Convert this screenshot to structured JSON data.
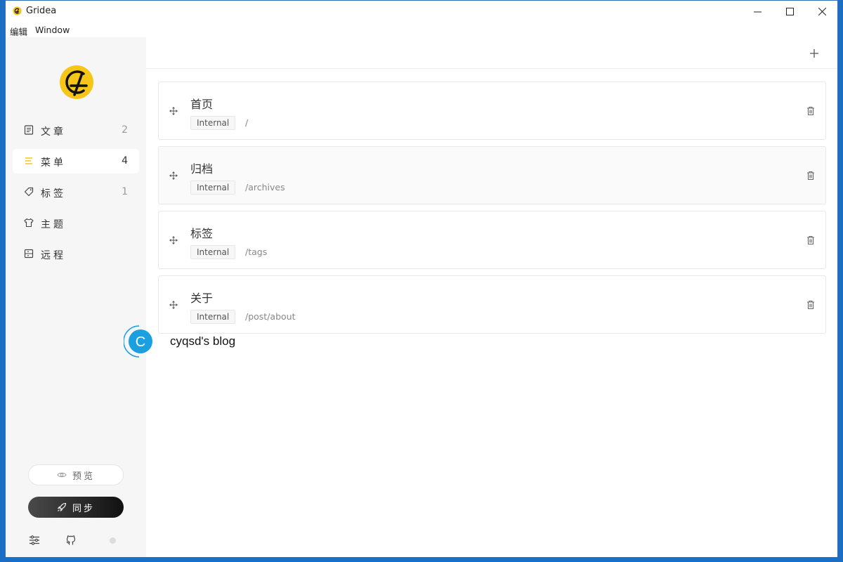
{
  "window": {
    "title": "Gridea"
  },
  "menubar": {
    "items": [
      "编辑",
      "Window"
    ]
  },
  "sidebar": {
    "nav": [
      {
        "label": "文章",
        "count": "2",
        "icon": "article-icon"
      },
      {
        "label": "菜单",
        "count": "4",
        "icon": "menu-icon",
        "active": true
      },
      {
        "label": "标签",
        "count": "1",
        "icon": "tag-icon"
      },
      {
        "label": "主题",
        "count": "",
        "icon": "shirt-icon"
      },
      {
        "label": "远程",
        "count": "",
        "icon": "remote-icon"
      }
    ],
    "preview_label": "预览",
    "sync_label": "同步"
  },
  "menus": [
    {
      "name": "首页",
      "type": "Internal",
      "link": "/"
    },
    {
      "name": "归档",
      "type": "Internal",
      "link": "/archives"
    },
    {
      "name": "标签",
      "type": "Internal",
      "link": "/tags"
    },
    {
      "name": "关于",
      "type": "Internal",
      "link": "/post/about"
    }
  ],
  "overlay": {
    "badge_letter": "C",
    "blog_name": "cyqsd's blog"
  },
  "colors": {
    "accent": "#f5c518",
    "badge": "#1a9fe0",
    "active_icon": "#f5c518"
  }
}
